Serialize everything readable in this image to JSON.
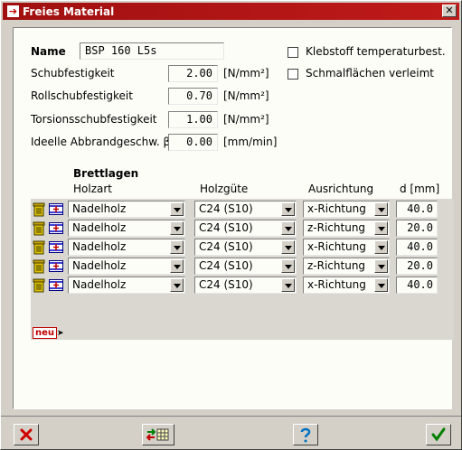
{
  "window": {
    "title": "Freies Material",
    "close_label": "✕"
  },
  "name": {
    "label": "Name",
    "value": "BSP 160 L5s"
  },
  "properties": [
    {
      "label": "Schubfestigkeit",
      "value": "2.00",
      "unit": "[N/mm²]"
    },
    {
      "label": "Rollschubfestigkeit",
      "value": "0.70",
      "unit": "[N/mm²]"
    },
    {
      "label": "Torsionsschubfestigkeit",
      "value": "1.00",
      "unit": "[N/mm²]"
    },
    {
      "label": "Ideelle Abbrandgeschw. β",
      "value": "0.00",
      "unit": "[mm/min]"
    }
  ],
  "options": [
    {
      "label": "Klebstoff temperaturbest.",
      "checked": false
    },
    {
      "label": "Schmalflächen verleimt",
      "checked": false
    }
  ],
  "layers": {
    "title": "Brettlagen",
    "headers": {
      "holzart": "Holzart",
      "holzguete": "Holzgüte",
      "ausrichtung": "Ausrichtung",
      "d": "d [mm]"
    },
    "rows": [
      {
        "holzart": "Nadelholz",
        "holzguete": "C24 (S10)",
        "ausrichtung": "x-Richtung",
        "d": "40.0"
      },
      {
        "holzart": "Nadelholz",
        "holzguete": "C24 (S10)",
        "ausrichtung": "z-Richtung",
        "d": "20.0"
      },
      {
        "holzart": "Nadelholz",
        "holzguete": "C24 (S10)",
        "ausrichtung": "x-Richtung",
        "d": "40.0"
      },
      {
        "holzart": "Nadelholz",
        "holzguete": "C24 (S10)",
        "ausrichtung": "z-Richtung",
        "d": "20.0"
      },
      {
        "holzart": "Nadelholz",
        "holzguete": "C24 (S10)",
        "ausrichtung": "x-Richtung",
        "d": "40.0"
      }
    ],
    "new_label": "neu"
  },
  "colors": {
    "title_bar": "#b01414",
    "panel": "#fdfdf7",
    "grid": "#d9d7d0",
    "new_button": "#c00000"
  },
  "buttons": [
    {
      "name": "cancel-button",
      "icon": "red-x-icon"
    },
    {
      "name": "import-button",
      "icon": "import-table-icon"
    },
    {
      "name": "help-button",
      "icon": "help-icon"
    },
    {
      "name": "ok-button",
      "icon": "green-check-icon"
    }
  ]
}
